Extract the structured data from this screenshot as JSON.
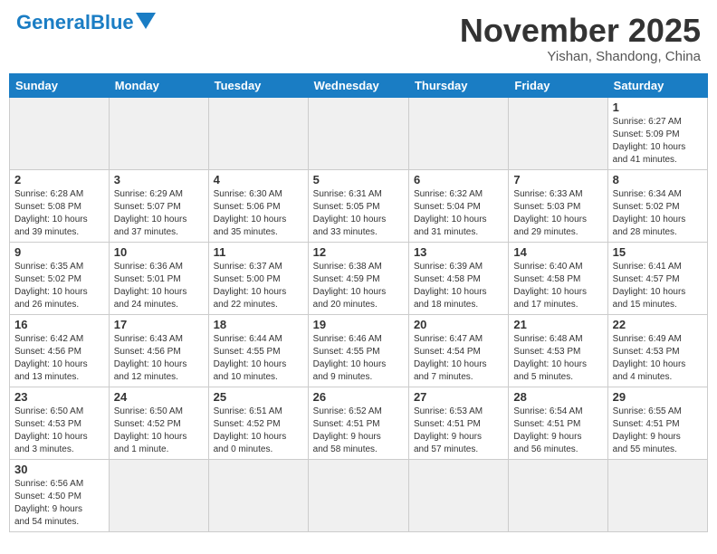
{
  "header": {
    "logo_general": "General",
    "logo_blue": "Blue",
    "month_title": "November 2025",
    "subtitle": "Yishan, Shandong, China"
  },
  "weekdays": [
    "Sunday",
    "Monday",
    "Tuesday",
    "Wednesday",
    "Thursday",
    "Friday",
    "Saturday"
  ],
  "days": {
    "d1": {
      "num": "1",
      "info": "Sunrise: 6:27 AM\nSunset: 5:09 PM\nDaylight: 10 hours\nand 41 minutes."
    },
    "d2": {
      "num": "2",
      "info": "Sunrise: 6:28 AM\nSunset: 5:08 PM\nDaylight: 10 hours\nand 39 minutes."
    },
    "d3": {
      "num": "3",
      "info": "Sunrise: 6:29 AM\nSunset: 5:07 PM\nDaylight: 10 hours\nand 37 minutes."
    },
    "d4": {
      "num": "4",
      "info": "Sunrise: 6:30 AM\nSunset: 5:06 PM\nDaylight: 10 hours\nand 35 minutes."
    },
    "d5": {
      "num": "5",
      "info": "Sunrise: 6:31 AM\nSunset: 5:05 PM\nDaylight: 10 hours\nand 33 minutes."
    },
    "d6": {
      "num": "6",
      "info": "Sunrise: 6:32 AM\nSunset: 5:04 PM\nDaylight: 10 hours\nand 31 minutes."
    },
    "d7": {
      "num": "7",
      "info": "Sunrise: 6:33 AM\nSunset: 5:03 PM\nDaylight: 10 hours\nand 29 minutes."
    },
    "d8": {
      "num": "8",
      "info": "Sunrise: 6:34 AM\nSunset: 5:02 PM\nDaylight: 10 hours\nand 28 minutes."
    },
    "d9": {
      "num": "9",
      "info": "Sunrise: 6:35 AM\nSunset: 5:02 PM\nDaylight: 10 hours\nand 26 minutes."
    },
    "d10": {
      "num": "10",
      "info": "Sunrise: 6:36 AM\nSunset: 5:01 PM\nDaylight: 10 hours\nand 24 minutes."
    },
    "d11": {
      "num": "11",
      "info": "Sunrise: 6:37 AM\nSunset: 5:00 PM\nDaylight: 10 hours\nand 22 minutes."
    },
    "d12": {
      "num": "12",
      "info": "Sunrise: 6:38 AM\nSunset: 4:59 PM\nDaylight: 10 hours\nand 20 minutes."
    },
    "d13": {
      "num": "13",
      "info": "Sunrise: 6:39 AM\nSunset: 4:58 PM\nDaylight: 10 hours\nand 18 minutes."
    },
    "d14": {
      "num": "14",
      "info": "Sunrise: 6:40 AM\nSunset: 4:58 PM\nDaylight: 10 hours\nand 17 minutes."
    },
    "d15": {
      "num": "15",
      "info": "Sunrise: 6:41 AM\nSunset: 4:57 PM\nDaylight: 10 hours\nand 15 minutes."
    },
    "d16": {
      "num": "16",
      "info": "Sunrise: 6:42 AM\nSunset: 4:56 PM\nDaylight: 10 hours\nand 13 minutes."
    },
    "d17": {
      "num": "17",
      "info": "Sunrise: 6:43 AM\nSunset: 4:56 PM\nDaylight: 10 hours\nand 12 minutes."
    },
    "d18": {
      "num": "18",
      "info": "Sunrise: 6:44 AM\nSunset: 4:55 PM\nDaylight: 10 hours\nand 10 minutes."
    },
    "d19": {
      "num": "19",
      "info": "Sunrise: 6:46 AM\nSunset: 4:55 PM\nDaylight: 10 hours\nand 9 minutes."
    },
    "d20": {
      "num": "20",
      "info": "Sunrise: 6:47 AM\nSunset: 4:54 PM\nDaylight: 10 hours\nand 7 minutes."
    },
    "d21": {
      "num": "21",
      "info": "Sunrise: 6:48 AM\nSunset: 4:53 PM\nDaylight: 10 hours\nand 5 minutes."
    },
    "d22": {
      "num": "22",
      "info": "Sunrise: 6:49 AM\nSunset: 4:53 PM\nDaylight: 10 hours\nand 4 minutes."
    },
    "d23": {
      "num": "23",
      "info": "Sunrise: 6:50 AM\nSunset: 4:53 PM\nDaylight: 10 hours\nand 3 minutes."
    },
    "d24": {
      "num": "24",
      "info": "Sunrise: 6:50 AM\nSunset: 4:52 PM\nDaylight: 10 hours\nand 1 minute."
    },
    "d25": {
      "num": "25",
      "info": "Sunrise: 6:51 AM\nSunset: 4:52 PM\nDaylight: 10 hours\nand 0 minutes."
    },
    "d26": {
      "num": "26",
      "info": "Sunrise: 6:52 AM\nSunset: 4:51 PM\nDaylight: 9 hours\nand 58 minutes."
    },
    "d27": {
      "num": "27",
      "info": "Sunrise: 6:53 AM\nSunset: 4:51 PM\nDaylight: 9 hours\nand 57 minutes."
    },
    "d28": {
      "num": "28",
      "info": "Sunrise: 6:54 AM\nSunset: 4:51 PM\nDaylight: 9 hours\nand 56 minutes."
    },
    "d29": {
      "num": "29",
      "info": "Sunrise: 6:55 AM\nSunset: 4:51 PM\nDaylight: 9 hours\nand 55 minutes."
    },
    "d30": {
      "num": "30",
      "info": "Sunrise: 6:56 AM\nSunset: 4:50 PM\nDaylight: 9 hours\nand 54 minutes."
    }
  }
}
